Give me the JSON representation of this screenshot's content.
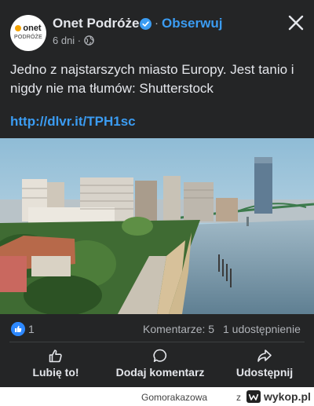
{
  "post": {
    "logo_text_top": "onet",
    "logo_text_bottom": "PODRÓŻE",
    "page_name": "Onet Podróże",
    "separator": "·",
    "follow_label": "Obserwuj",
    "time": "6 dni ·",
    "text": "Jedno z najstarszych miasto Europy. Jest tanio i nigdy nie ma tłumów: Shutterstock",
    "link": "http://dlvr.it/TPH1sc",
    "icons": {
      "verified": "verified-badge-icon",
      "close": "close-icon",
      "audience": "globe-icon"
    }
  },
  "stats": {
    "like_count": "1",
    "comments": "Komentarze: 5",
    "shares": "1 udostępnienie"
  },
  "actions": {
    "like": "Lubię to!",
    "comment": "Dodaj komentarz",
    "share": "Udostępnij"
  },
  "footer": {
    "username": "Gomorakazowa",
    "z": "z",
    "site": "wykop.pl"
  },
  "colors": {
    "background": "#242526",
    "text": "#e4e6eb",
    "secondary_text": "#b0b3b8",
    "link": "#3b9cf2",
    "like_badge": "#2d88ff"
  }
}
